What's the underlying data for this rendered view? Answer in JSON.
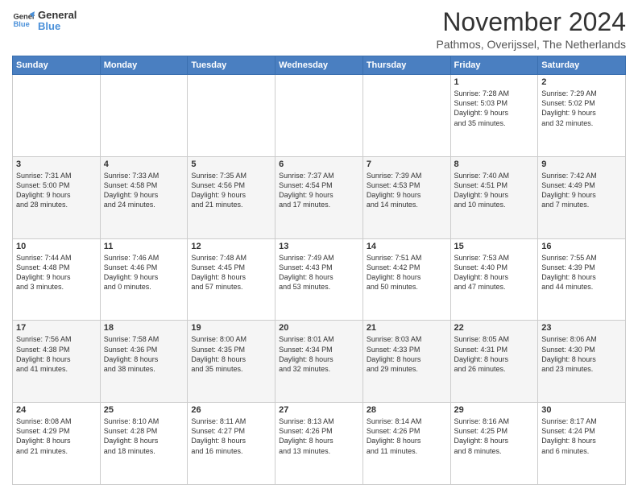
{
  "header": {
    "logo_line1": "General",
    "logo_line2": "Blue",
    "month_title": "November 2024",
    "location": "Pathmos, Overijssel, The Netherlands"
  },
  "days_of_week": [
    "Sunday",
    "Monday",
    "Tuesday",
    "Wednesday",
    "Thursday",
    "Friday",
    "Saturday"
  ],
  "weeks": [
    [
      {
        "day": "",
        "info": ""
      },
      {
        "day": "",
        "info": ""
      },
      {
        "day": "",
        "info": ""
      },
      {
        "day": "",
        "info": ""
      },
      {
        "day": "",
        "info": ""
      },
      {
        "day": "1",
        "info": "Sunrise: 7:28 AM\nSunset: 5:03 PM\nDaylight: 9 hours\nand 35 minutes."
      },
      {
        "day": "2",
        "info": "Sunrise: 7:29 AM\nSunset: 5:02 PM\nDaylight: 9 hours\nand 32 minutes."
      }
    ],
    [
      {
        "day": "3",
        "info": "Sunrise: 7:31 AM\nSunset: 5:00 PM\nDaylight: 9 hours\nand 28 minutes."
      },
      {
        "day": "4",
        "info": "Sunrise: 7:33 AM\nSunset: 4:58 PM\nDaylight: 9 hours\nand 24 minutes."
      },
      {
        "day": "5",
        "info": "Sunrise: 7:35 AM\nSunset: 4:56 PM\nDaylight: 9 hours\nand 21 minutes."
      },
      {
        "day": "6",
        "info": "Sunrise: 7:37 AM\nSunset: 4:54 PM\nDaylight: 9 hours\nand 17 minutes."
      },
      {
        "day": "7",
        "info": "Sunrise: 7:39 AM\nSunset: 4:53 PM\nDaylight: 9 hours\nand 14 minutes."
      },
      {
        "day": "8",
        "info": "Sunrise: 7:40 AM\nSunset: 4:51 PM\nDaylight: 9 hours\nand 10 minutes."
      },
      {
        "day": "9",
        "info": "Sunrise: 7:42 AM\nSunset: 4:49 PM\nDaylight: 9 hours\nand 7 minutes."
      }
    ],
    [
      {
        "day": "10",
        "info": "Sunrise: 7:44 AM\nSunset: 4:48 PM\nDaylight: 9 hours\nand 3 minutes."
      },
      {
        "day": "11",
        "info": "Sunrise: 7:46 AM\nSunset: 4:46 PM\nDaylight: 9 hours\nand 0 minutes."
      },
      {
        "day": "12",
        "info": "Sunrise: 7:48 AM\nSunset: 4:45 PM\nDaylight: 8 hours\nand 57 minutes."
      },
      {
        "day": "13",
        "info": "Sunrise: 7:49 AM\nSunset: 4:43 PM\nDaylight: 8 hours\nand 53 minutes."
      },
      {
        "day": "14",
        "info": "Sunrise: 7:51 AM\nSunset: 4:42 PM\nDaylight: 8 hours\nand 50 minutes."
      },
      {
        "day": "15",
        "info": "Sunrise: 7:53 AM\nSunset: 4:40 PM\nDaylight: 8 hours\nand 47 minutes."
      },
      {
        "day": "16",
        "info": "Sunrise: 7:55 AM\nSunset: 4:39 PM\nDaylight: 8 hours\nand 44 minutes."
      }
    ],
    [
      {
        "day": "17",
        "info": "Sunrise: 7:56 AM\nSunset: 4:38 PM\nDaylight: 8 hours\nand 41 minutes."
      },
      {
        "day": "18",
        "info": "Sunrise: 7:58 AM\nSunset: 4:36 PM\nDaylight: 8 hours\nand 38 minutes."
      },
      {
        "day": "19",
        "info": "Sunrise: 8:00 AM\nSunset: 4:35 PM\nDaylight: 8 hours\nand 35 minutes."
      },
      {
        "day": "20",
        "info": "Sunrise: 8:01 AM\nSunset: 4:34 PM\nDaylight: 8 hours\nand 32 minutes."
      },
      {
        "day": "21",
        "info": "Sunrise: 8:03 AM\nSunset: 4:33 PM\nDaylight: 8 hours\nand 29 minutes."
      },
      {
        "day": "22",
        "info": "Sunrise: 8:05 AM\nSunset: 4:31 PM\nDaylight: 8 hours\nand 26 minutes."
      },
      {
        "day": "23",
        "info": "Sunrise: 8:06 AM\nSunset: 4:30 PM\nDaylight: 8 hours\nand 23 minutes."
      }
    ],
    [
      {
        "day": "24",
        "info": "Sunrise: 8:08 AM\nSunset: 4:29 PM\nDaylight: 8 hours\nand 21 minutes."
      },
      {
        "day": "25",
        "info": "Sunrise: 8:10 AM\nSunset: 4:28 PM\nDaylight: 8 hours\nand 18 minutes."
      },
      {
        "day": "26",
        "info": "Sunrise: 8:11 AM\nSunset: 4:27 PM\nDaylight: 8 hours\nand 16 minutes."
      },
      {
        "day": "27",
        "info": "Sunrise: 8:13 AM\nSunset: 4:26 PM\nDaylight: 8 hours\nand 13 minutes."
      },
      {
        "day": "28",
        "info": "Sunrise: 8:14 AM\nSunset: 4:26 PM\nDaylight: 8 hours\nand 11 minutes."
      },
      {
        "day": "29",
        "info": "Sunrise: 8:16 AM\nSunset: 4:25 PM\nDaylight: 8 hours\nand 8 minutes."
      },
      {
        "day": "30",
        "info": "Sunrise: 8:17 AM\nSunset: 4:24 PM\nDaylight: 8 hours\nand 6 minutes."
      }
    ]
  ]
}
